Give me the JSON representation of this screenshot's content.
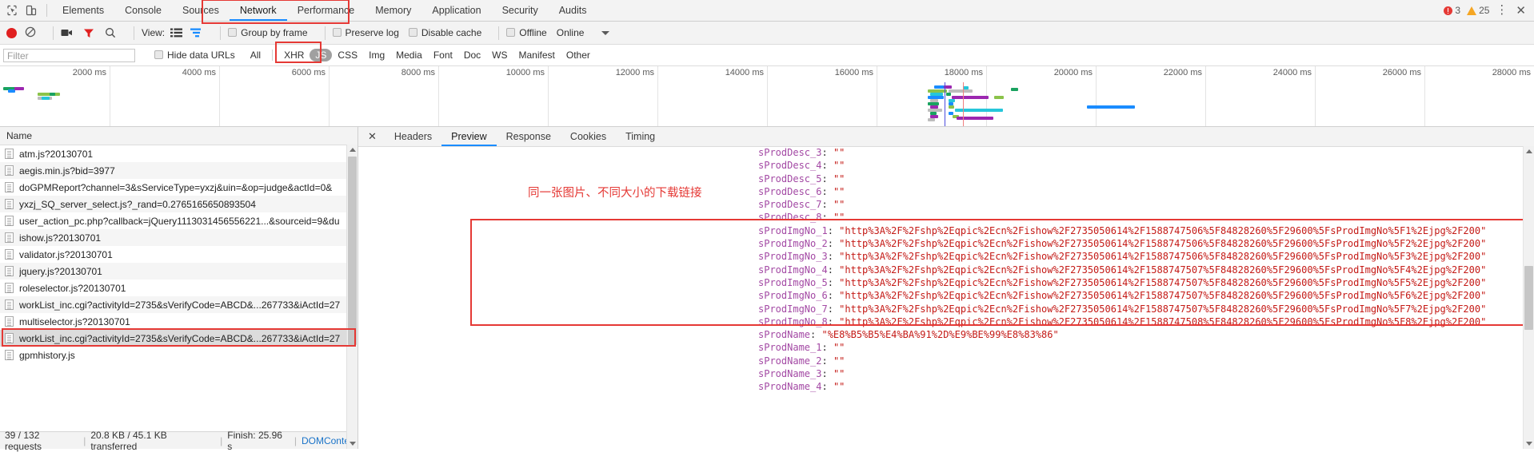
{
  "window": {
    "devtools_tabs": [
      {
        "label": "Elements",
        "active": false
      },
      {
        "label": "Console",
        "active": false
      },
      {
        "label": "Sources",
        "active": false
      },
      {
        "label": "Network",
        "active": true
      },
      {
        "label": "Performance",
        "active": false
      },
      {
        "label": "Memory",
        "active": false
      },
      {
        "label": "Application",
        "active": false
      },
      {
        "label": "Security",
        "active": false
      },
      {
        "label": "Audits",
        "active": false
      }
    ],
    "error_count": "3",
    "warning_count": "25",
    "inspect_icon": "inspect-element-icon",
    "device_icon": "device-toolbar-icon",
    "menu_icon": "vertical-dots-icon",
    "close_icon": "close-icon"
  },
  "network_toolbar": {
    "record_icon": "record-button-icon",
    "clear_icon": "clear-icon",
    "capture_screenshots_icon": "camera-icon",
    "filter_icon": "funnel-icon",
    "search_icon": "search-icon",
    "view_label": "View:",
    "view_list_icon": "list-view-icon",
    "view_waterfall_icon": "waterfall-view-icon",
    "group_by_frame": "Group by frame",
    "preserve_log": "Preserve log",
    "disable_cache": "Disable cache",
    "offline": "Offline",
    "online": "Online",
    "throttle_caret_icon": "chevron-down-icon"
  },
  "filter_row": {
    "filter_placeholder": "Filter",
    "filter_value": "",
    "hide_data_urls": "Hide data URLs",
    "types": [
      {
        "label": "All",
        "selected": false
      },
      {
        "label": "XHR",
        "selected": false
      },
      {
        "label": "JS",
        "selected": true
      },
      {
        "label": "CSS",
        "selected": false
      },
      {
        "label": "Img",
        "selected": false
      },
      {
        "label": "Media",
        "selected": false
      },
      {
        "label": "Font",
        "selected": false
      },
      {
        "label": "Doc",
        "selected": false
      },
      {
        "label": "WS",
        "selected": false
      },
      {
        "label": "Manifest",
        "selected": false
      },
      {
        "label": "Other",
        "selected": false
      }
    ]
  },
  "overview": {
    "ticks": [
      "2000 ms",
      "4000 ms",
      "6000 ms",
      "8000 ms",
      "10000 ms",
      "12000 ms",
      "14000 ms",
      "16000 ms",
      "18000 ms",
      "20000 ms",
      "22000 ms",
      "24000 ms",
      "26000 ms",
      "28000 ms"
    ],
    "dom_content_loaded_color": "#4b4bdc",
    "load_event_color": "#f08080"
  },
  "request_list": {
    "column_header": "Name",
    "rows": [
      {
        "name": "atm.js?20130701",
        "selected": false,
        "annotated": false
      },
      {
        "name": "aegis.min.js?bid=3977",
        "selected": false,
        "annotated": false
      },
      {
        "name": "doGPMReport?channel=3&sServiceType=yxzj&uin=&op=judge&actId=0&",
        "selected": false,
        "annotated": false
      },
      {
        "name": "yxzj_SQ_server_select.js?_rand=0.2765165650893504",
        "selected": false,
        "annotated": false
      },
      {
        "name": "user_action_pc.php?callback=jQuery1113031456556221...&sourceid=9&du",
        "selected": false,
        "annotated": false
      },
      {
        "name": "ishow.js?20130701",
        "selected": false,
        "annotated": false
      },
      {
        "name": "validator.js?20130701",
        "selected": false,
        "annotated": false
      },
      {
        "name": "jquery.js?20130701",
        "selected": false,
        "annotated": false
      },
      {
        "name": "roleselector.js?20130701",
        "selected": false,
        "annotated": false
      },
      {
        "name": "workList_inc.cgi?activityId=2735&sVerifyCode=ABCD&...267733&iActId=27",
        "selected": false,
        "annotated": false
      },
      {
        "name": "multiselector.js?20130701",
        "selected": false,
        "annotated": false
      },
      {
        "name": "workList_inc.cgi?activityId=2735&sVerifyCode=ABCD&...267733&iActId=27",
        "selected": true,
        "annotated": true
      },
      {
        "name": "gpmhistory.js",
        "selected": false,
        "annotated": false
      }
    ]
  },
  "status_bar": {
    "requests": "39 / 132 requests",
    "transferred": "20.8 KB / 45.1 KB transferred",
    "finish": "Finish: 25.96 s",
    "dom_content_loaded": "DOMConte..."
  },
  "detail_panel": {
    "close_icon": "close-icon",
    "tabs": [
      {
        "label": "Headers",
        "active": false
      },
      {
        "label": "Preview",
        "active": true
      },
      {
        "label": "Response",
        "active": false
      },
      {
        "label": "Cookies",
        "active": false
      },
      {
        "label": "Timing",
        "active": false
      }
    ],
    "annotation_note": "同一张图片、不同大小的下载链接",
    "preview_lines": [
      {
        "key": "sProdDesc_3",
        "value": "\"\"",
        "highlight": false
      },
      {
        "key": "sProdDesc_4",
        "value": "\"\"",
        "highlight": false
      },
      {
        "key": "sProdDesc_5",
        "value": "\"\"",
        "highlight": false
      },
      {
        "key": "sProdDesc_6",
        "value": "\"\"",
        "highlight": false
      },
      {
        "key": "sProdDesc_7",
        "value": "\"\"",
        "highlight": false
      },
      {
        "key": "sProdDesc_8",
        "value": "\"\"",
        "highlight": false
      },
      {
        "key": "sProdImgNo_1",
        "value": "\"http%3A%2F%2Fshp%2Eqpic%2Ecn%2Fishow%2F2735050614%2F1588747506%5F84828260%5F29600%5FsProdImgNo%5F1%2Ejpg%2F200\"",
        "highlight": true
      },
      {
        "key": "sProdImgNo_2",
        "value": "\"http%3A%2F%2Fshp%2Eqpic%2Ecn%2Fishow%2F2735050614%2F1588747506%5F84828260%5F29600%5FsProdImgNo%5F2%2Ejpg%2F200\"",
        "highlight": true
      },
      {
        "key": "sProdImgNo_3",
        "value": "\"http%3A%2F%2Fshp%2Eqpic%2Ecn%2Fishow%2F2735050614%2F1588747506%5F84828260%5F29600%5FsProdImgNo%5F3%2Ejpg%2F200\"",
        "highlight": true
      },
      {
        "key": "sProdImgNo_4",
        "value": "\"http%3A%2F%2Fshp%2Eqpic%2Ecn%2Fishow%2F2735050614%2F1588747507%5F84828260%5F29600%5FsProdImgNo%5F4%2Ejpg%2F200\"",
        "highlight": true
      },
      {
        "key": "sProdImgNo_5",
        "value": "\"http%3A%2F%2Fshp%2Eqpic%2Ecn%2Fishow%2F2735050614%2F1588747507%5F84828260%5F29600%5FsProdImgNo%5F5%2Ejpg%2F200\"",
        "highlight": true
      },
      {
        "key": "sProdImgNo_6",
        "value": "\"http%3A%2F%2Fshp%2Eqpic%2Ecn%2Fishow%2F2735050614%2F1588747507%5F84828260%5F29600%5FsProdImgNo%5F6%2Ejpg%2F200\"",
        "highlight": true
      },
      {
        "key": "sProdImgNo_7",
        "value": "\"http%3A%2F%2Fshp%2Eqpic%2Ecn%2Fishow%2F2735050614%2F1588747507%5F84828260%5F29600%5FsProdImgNo%5F7%2Ejpg%2F200\"",
        "highlight": true
      },
      {
        "key": "sProdImgNo_8",
        "value": "\"http%3A%2F%2Fshp%2Eqpic%2Ecn%2Fishow%2F2735050614%2F1588747508%5F84828260%5F29600%5FsProdImgNo%5F8%2Ejpg%2F200\"",
        "highlight": true
      },
      {
        "key": "sProdName",
        "value": "\"%E8%B5%B5%E4%BA%91%2D%E9%BE%99%E8%83%86\"",
        "highlight": false
      },
      {
        "key": "sProdName_1",
        "value": "\"\"",
        "highlight": false
      },
      {
        "key": "sProdName_2",
        "value": "\"\"",
        "highlight": false
      },
      {
        "key": "sProdName_3",
        "value": "\"\"",
        "highlight": false
      },
      {
        "key": "sProdName_4",
        "value": "\"\"",
        "highlight": false
      }
    ]
  },
  "colors": {
    "annotation_red": "#e53935",
    "tab_accent": "#1a8cff",
    "selected_row": "#dcdcdc"
  }
}
